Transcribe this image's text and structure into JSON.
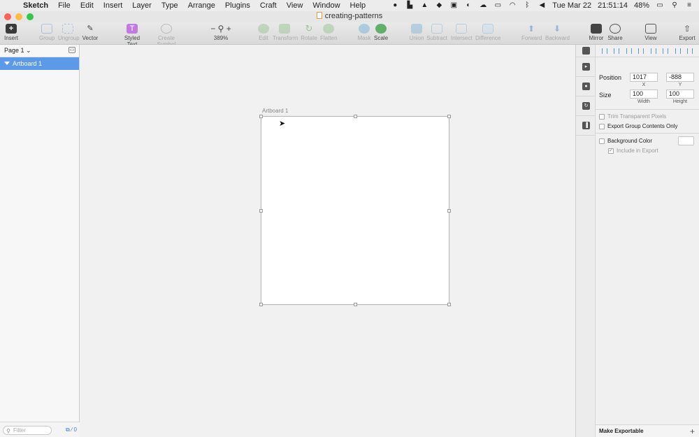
{
  "menubar": {
    "app": "Sketch",
    "items": [
      "File",
      "Edit",
      "Insert",
      "Layer",
      "Type",
      "Arrange",
      "Plugins",
      "Craft",
      "View",
      "Window",
      "Help"
    ],
    "day": "Tue Mar 22",
    "time": "21:51:14",
    "battery": "48%"
  },
  "window": {
    "doc_title": "creating-patterns",
    "traffic": {
      "close": "#fc605c",
      "minimize": "#fdbc40",
      "zoom": "#34c84a"
    }
  },
  "toolbar": {
    "insert": "Insert",
    "group": "Group",
    "ungroup": "Ungroup",
    "vector": "Vector",
    "styled_text": "Styled Text",
    "create_symbol": "Create Symbol",
    "zoom_minus": "−",
    "zoom_plus": "+",
    "zoom_level": "389%",
    "edit": "Edit",
    "transform": "Transform",
    "rotate": "Rotate",
    "flatten": "Flatten",
    "mask": "Mask",
    "scale": "Scale",
    "union": "Union",
    "subtract": "Subtract",
    "intersect": "Intersect",
    "difference": "Difference",
    "forward": "Forward",
    "backward": "Backward",
    "mirror": "Mirror",
    "share": "Share",
    "view": "View",
    "export": "Export",
    "styled_text_icon": "T",
    "styled_text_color": "#c27ae0"
  },
  "layers": {
    "page": "Page 1",
    "items": [
      {
        "label": "Artboard 1",
        "selected": true
      }
    ],
    "filter_placeholder": "Filter",
    "slice_count": "0",
    "selection_color": "#5b9ae8"
  },
  "canvas": {
    "artboard_label": "Artboard 1"
  },
  "inspector": {
    "position_label": "Position",
    "x": "1017",
    "y": "-888",
    "x_label": "X",
    "y_label": "Y",
    "size_label": "Size",
    "width": "100",
    "height": "100",
    "width_label": "Width",
    "height_label": "Height",
    "trim_transparent": "Trim Transparent Pixels",
    "export_group_contents": "Export Group Contents Only",
    "background_color": "Background Color",
    "include_in_export": "Include in Export",
    "make_exportable": "Make Exportable",
    "add": "+"
  }
}
